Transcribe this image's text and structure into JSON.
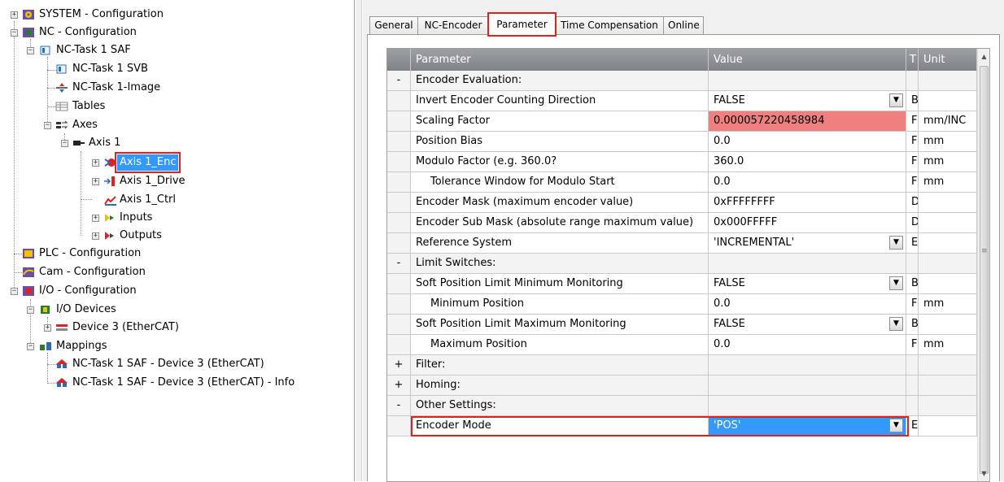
{
  "tree": {
    "items": [
      {
        "label": "SYSTEM - Configuration",
        "icon": "system-config-icon"
      },
      {
        "label": "NC - Configuration",
        "icon": "nc-config-icon"
      },
      {
        "label": "NC-Task 1 SAF",
        "icon": "task-icon"
      },
      {
        "label": "NC-Task 1 SVB",
        "icon": "task-icon"
      },
      {
        "label": "NC-Task 1-Image",
        "icon": "image-icon"
      },
      {
        "label": "Tables",
        "icon": "table-icon"
      },
      {
        "label": "Axes",
        "icon": "axes-icon"
      },
      {
        "label": "Axis 1",
        "icon": "axis-icon"
      },
      {
        "label": "Axis 1_Enc",
        "icon": "encoder-icon"
      },
      {
        "label": "Axis 1_Drive",
        "icon": "drive-icon"
      },
      {
        "label": "Axis 1_Ctrl",
        "icon": "controller-icon"
      },
      {
        "label": "Inputs",
        "icon": "inputs-icon"
      },
      {
        "label": "Outputs",
        "icon": "outputs-icon"
      },
      {
        "label": "PLC - Configuration",
        "icon": "plc-config-icon"
      },
      {
        "label": "Cam - Configuration",
        "icon": "cam-config-icon"
      },
      {
        "label": "I/O - Configuration",
        "icon": "io-config-icon"
      },
      {
        "label": "I/O Devices",
        "icon": "io-devices-icon"
      },
      {
        "label": "Device 3 (EtherCAT)",
        "icon": "ethercat-device-icon"
      },
      {
        "label": "Mappings",
        "icon": "mappings-icon"
      },
      {
        "label": "NC-Task 1 SAF - Device 3 (EtherCAT)",
        "icon": "mapping-icon"
      },
      {
        "label": "NC-Task 1 SAF - Device 3 (EtherCAT) - Info",
        "icon": "mapping-icon"
      }
    ]
  },
  "tabs": [
    {
      "label": "General"
    },
    {
      "label": "NC-Encoder"
    },
    {
      "label": "Parameter"
    },
    {
      "label": "Time Compensation"
    },
    {
      "label": "Online"
    }
  ],
  "grid": {
    "headers": {
      "parameter": "Parameter",
      "value": "Value",
      "type": "T",
      "unit": "Unit"
    },
    "rows": [
      {
        "kind": "section",
        "toggle": "-",
        "name": "Encoder Evaluation:"
      },
      {
        "kind": "param",
        "name": "Invert Encoder Counting Direction",
        "value": "FALSE",
        "type": "B",
        "unit": "",
        "dropdown": true
      },
      {
        "kind": "param",
        "name": "Scaling Factor",
        "value": "0.000057220458984",
        "type": "F",
        "unit": "mm/INC",
        "state": "error"
      },
      {
        "kind": "param",
        "name": "Position Bias",
        "value": "0.0",
        "type": "F",
        "unit": "mm"
      },
      {
        "kind": "param",
        "name": "Modulo Factor (e.g. 360.0?",
        "value": "360.0",
        "type": "F",
        "unit": "mm"
      },
      {
        "kind": "param",
        "name": "Tolerance Window for Modulo Start",
        "value": "0.0",
        "type": "F",
        "unit": "mm",
        "indent": true
      },
      {
        "kind": "param",
        "name": "Encoder Mask (maximum encoder value)",
        "value": "0xFFFFFFFF",
        "type": "D",
        "unit": ""
      },
      {
        "kind": "param",
        "name": "Encoder Sub Mask (absolute range maximum value)",
        "value": "0x000FFFFF",
        "type": "D",
        "unit": ""
      },
      {
        "kind": "param",
        "name": "Reference System",
        "value": "'INCREMENTAL'",
        "type": "E",
        "unit": "",
        "dropdown": true
      },
      {
        "kind": "section",
        "toggle": "-",
        "name": "Limit Switches:"
      },
      {
        "kind": "param",
        "name": "Soft Position Limit Minimum Monitoring",
        "value": "FALSE",
        "type": "B",
        "unit": "",
        "dropdown": true
      },
      {
        "kind": "param",
        "name": "Minimum Position",
        "value": "0.0",
        "type": "F",
        "unit": "mm",
        "indent": true
      },
      {
        "kind": "param",
        "name": "Soft Position Limit Maximum Monitoring",
        "value": "FALSE",
        "type": "B",
        "unit": "",
        "dropdown": true
      },
      {
        "kind": "param",
        "name": "Maximum Position",
        "value": "0.0",
        "type": "F",
        "unit": "mm",
        "indent": true
      },
      {
        "kind": "section",
        "toggle": "+",
        "name": "Filter:"
      },
      {
        "kind": "section",
        "toggle": "+",
        "name": "Homing:"
      },
      {
        "kind": "section",
        "toggle": "-",
        "name": "Other Settings:"
      },
      {
        "kind": "param",
        "name": "Encoder Mode",
        "value": "'POS'",
        "type": "E",
        "unit": "",
        "dropdown": true,
        "state": "selected"
      }
    ]
  },
  "colors": {
    "highlight_frame": "#e0211f",
    "selection": "#3399ff",
    "error_cell": "#f08080",
    "header": "#8e9195"
  }
}
